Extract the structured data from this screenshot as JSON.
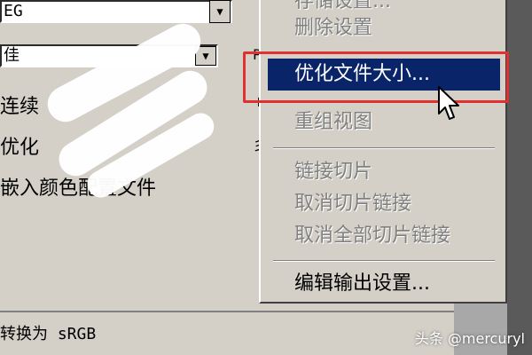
{
  "left_panel": {
    "format_value": "EG",
    "quality_value": "佳",
    "option_continuous": "连续",
    "option_optimize": "优化",
    "option_embed_profile": "嵌入颜色配置文件",
    "convert_label": "转换为 sRGB",
    "dropdown_arrow": "▼"
  },
  "menu": {
    "items": [
      {
        "label": "存储设置...",
        "state": "disabled"
      },
      {
        "label": "删除设置",
        "state": "disabled"
      },
      {
        "label": "优化文件大小...",
        "state": "highlighted"
      },
      {
        "label": "重组视图",
        "state": "disabled"
      },
      {
        "label": "链接切片",
        "state": "disabled"
      },
      {
        "label": "取消切片链接",
        "state": "disabled"
      },
      {
        "label": "取消全部切片链接",
        "state": "disabled"
      },
      {
        "label": "编辑输出设置...",
        "state": "enabled"
      }
    ]
  },
  "watermark": "头条 @mercuryl",
  "colors": {
    "highlight": "#0a246a",
    "annotation_box": "#e0302f",
    "face": "#d4d0c8"
  }
}
